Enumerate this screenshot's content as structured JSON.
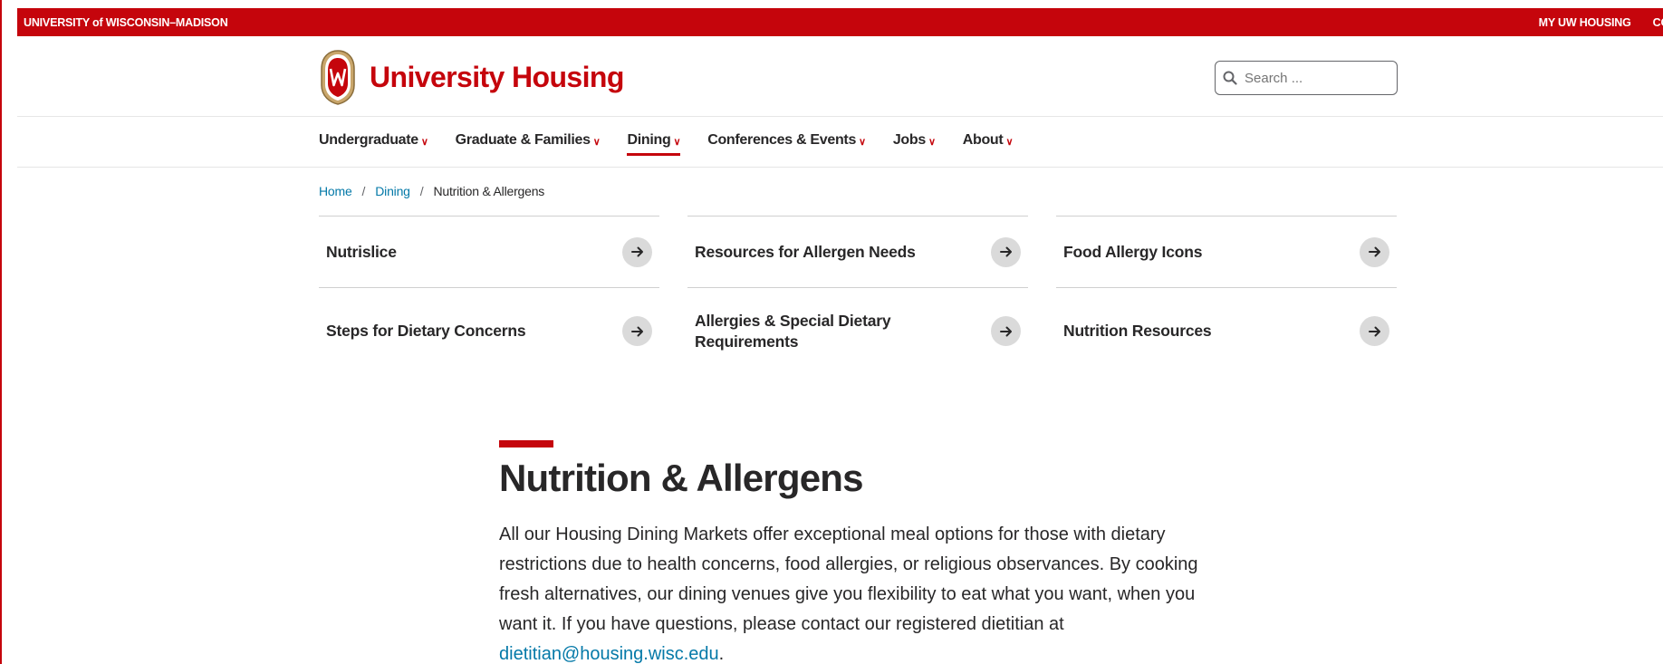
{
  "global_bar": {
    "university": "UNIVERSITY of WISCONSIN–MADISON",
    "links": [
      "MY UW HOUSING",
      "CONTAC"
    ]
  },
  "header": {
    "site_title": "University Housing",
    "logo_icon": "uw-crest-icon"
  },
  "search": {
    "placeholder": "Search ...",
    "icon": "search-icon"
  },
  "nav": {
    "items": [
      {
        "label": "Undergraduate"
      },
      {
        "label": "Graduate & Families"
      },
      {
        "label": "Dining",
        "active": true
      },
      {
        "label": "Conferences & Events"
      },
      {
        "label": "Jobs"
      },
      {
        "label": "About"
      }
    ]
  },
  "breadcrumb": {
    "home": "Home",
    "dining": "Dining",
    "current": "Nutrition & Allergens",
    "separator": "/"
  },
  "cards": [
    {
      "label": "Nutrislice"
    },
    {
      "label": "Resources for Allergen Needs"
    },
    {
      "label": "Food Allergy Icons"
    },
    {
      "label": "Steps for Dietary Concerns"
    },
    {
      "label": "Allergies & Special Dietary Requirements"
    },
    {
      "label": "Nutrition Resources"
    }
  ],
  "content": {
    "title": "Nutrition & Allergens",
    "intro": "All our Housing Dining Markets offer exceptional meal options for those with dietary restrictions due to health concerns, food allergies, or religious observances. By cooking fresh alternatives, our dining venues give you flexibility to eat what you want, when you want it. If you have questions, please contact our registered dietitian at ",
    "email": "dietitian@housing.wisc.edu",
    "intro_end": "."
  },
  "colors": {
    "brand_red": "#c5050c",
    "link_blue": "#0479a8",
    "text": "#282728"
  }
}
